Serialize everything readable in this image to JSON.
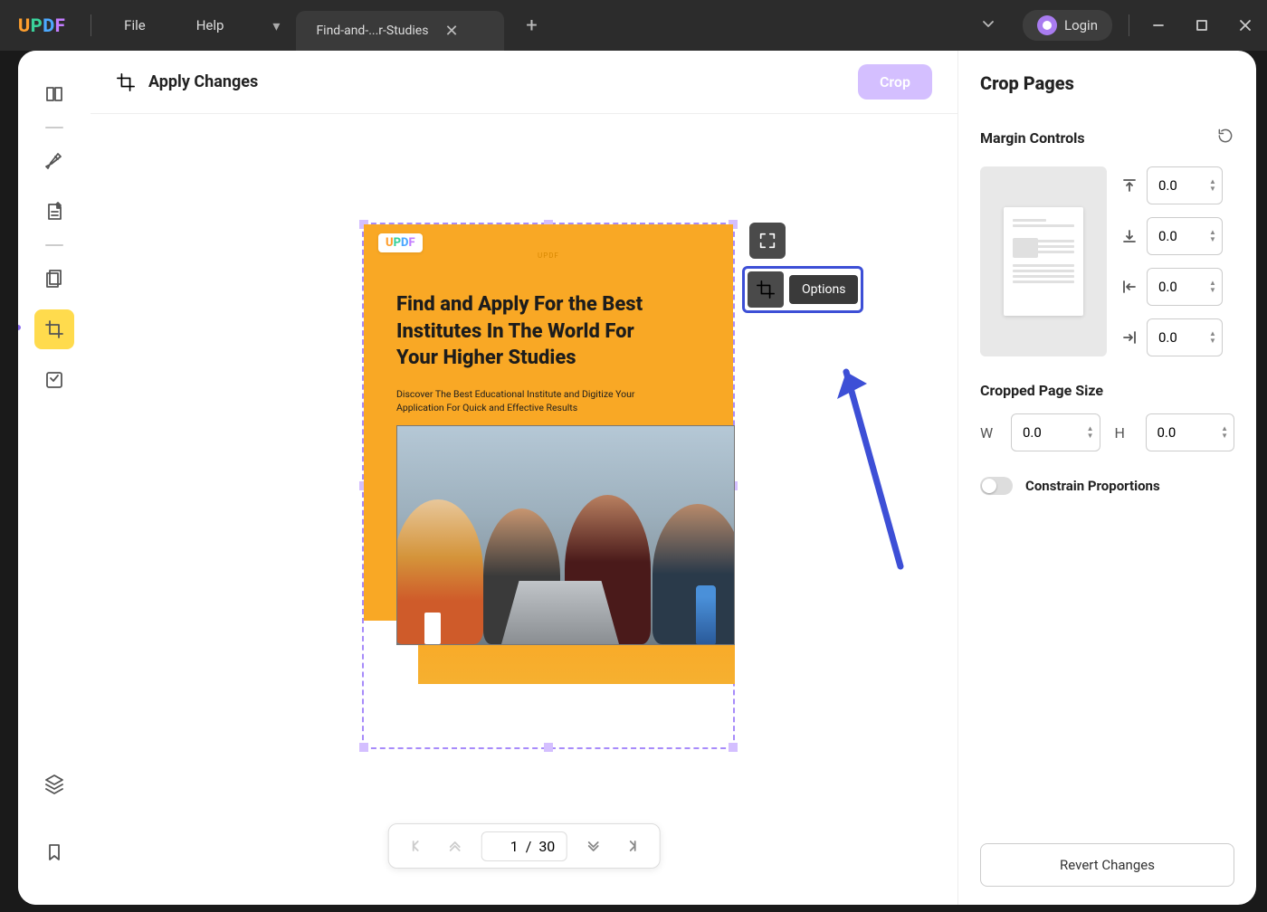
{
  "titlebar": {
    "menu_file": "File",
    "menu_help": "Help",
    "tab_title": "Find-and-...r-Studies",
    "login_label": "Login"
  },
  "topbar": {
    "title": "Apply Changes",
    "crop_label": "Crop"
  },
  "document": {
    "watermark": "UPDF",
    "title": "Find and Apply For the Best Institutes In The World For Your Higher Studies",
    "subtitle": "Discover The Best Educational Institute and Digitize Your Application For Quick and Effective Results"
  },
  "float": {
    "options_label": "Options"
  },
  "pagenav": {
    "current": "1",
    "total": "30",
    "separator": "/"
  },
  "rightpanel": {
    "title": "Crop Pages",
    "margin_title": "Margin Controls",
    "margins": {
      "top": "0.0",
      "bottom": "0.0",
      "left": "0.0",
      "right": "0.0"
    },
    "cropped_title": "Cropped Page Size",
    "size": {
      "w_label": "W",
      "w": "0.0",
      "h_label": "H",
      "h": "0.0"
    },
    "constrain_label": "Constrain Proportions",
    "revert_label": "Revert Changes"
  }
}
